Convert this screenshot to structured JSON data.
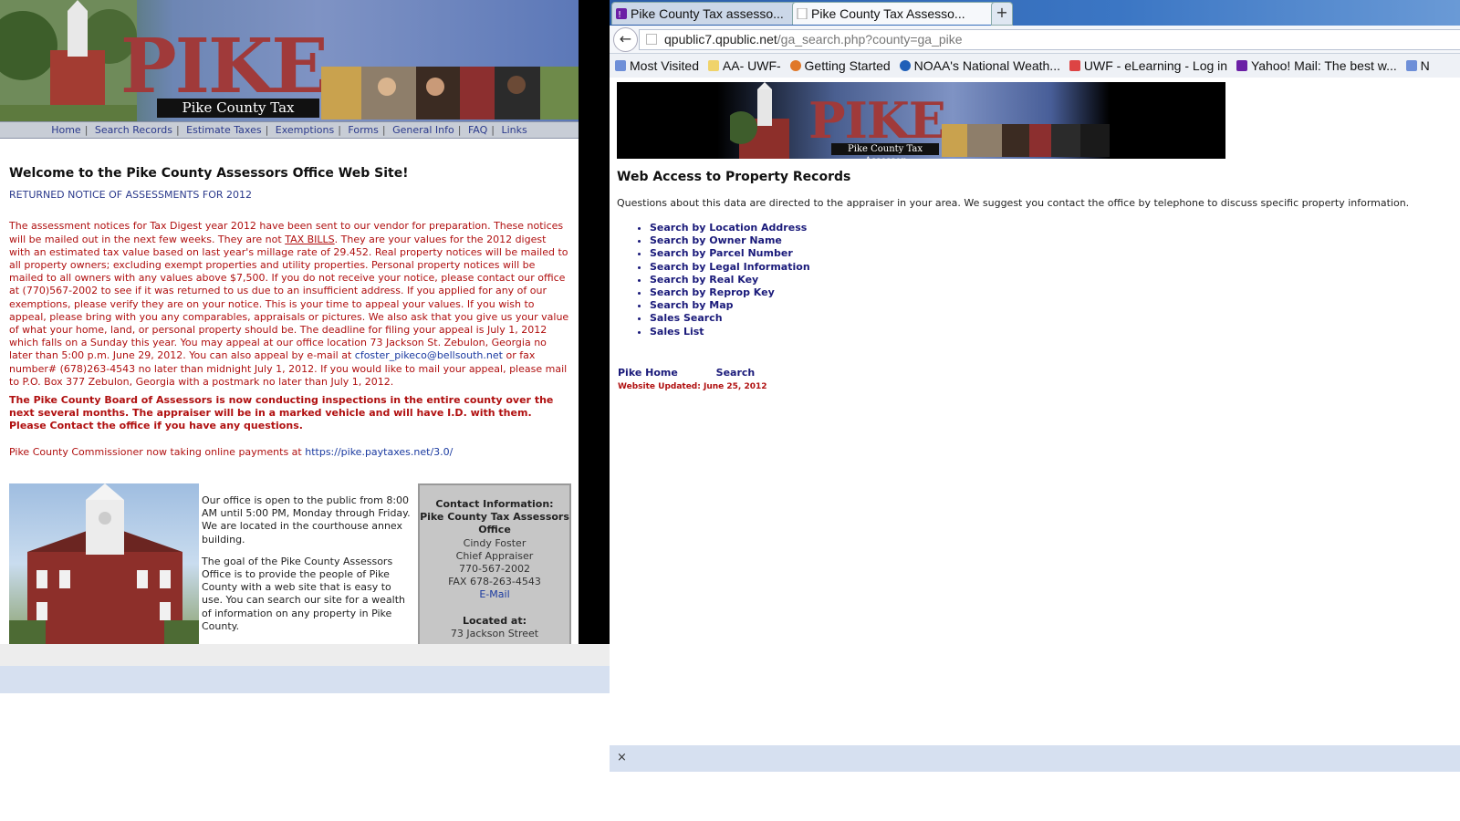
{
  "left": {
    "banner": {
      "logo_text": "PIKE",
      "tagline": "Pike County Tax Assessor"
    },
    "nav": [
      "Home",
      "Search Records",
      "Estimate Taxes",
      "Exemptions",
      "Forms",
      "General Info",
      "FAQ",
      "Links"
    ],
    "welcome_title": "Welcome to the Pike County Assessors Office Web Site!",
    "returned_notice": "RETURNED NOTICE OF ASSESSMENTS FOR 2012",
    "assessment_paragraph": {
      "before_link": "The assessment notices for Tax Digest year 2012 have been sent to our vendor for preparation. These notices will be mailed out in the next few weeks. They are not ",
      "tax_bills": "TAX BILLS",
      "middle": ". They are your values for the 2012 digest with an estimated tax value based on last year's millage rate of 29.452. Real property notices will be mailed to all property owners; excluding exempt properties and utility properties. Personal property notices will be mailed to all owners with any values above $7,500. If you do not receive your notice, please contact our office at (770)567-2002 to see if it was returned to us due to an insufficient address. If you applied for any of our exemptions, please verify they are on your notice. This is your time to appeal your values. If you wish to appeal, please bring with you any comparables, appraisals or pictures. We also ask that you give us your value of what your home, land, or personal property should be. The deadline for filing your appeal is July 1, 2012 which falls on a Sunday this year. You may appeal at our office location 73 Jackson St. Zebulon, Georgia no later than 5:00 p.m. June 29, 2012. You can also appeal by e-mail at ",
      "email": "cfoster_pikeco@bellsouth.net",
      "after_email": " or fax number# (678)263-4543 no later than midnight July 1, 2012. If you would like to mail your appeal, please mail to P.O. Box 377 Zebulon, Georgia with a postmark no later than July 1, 2012."
    },
    "inspection_notice": "The Pike County Board of Assessors is now conducting inspections in the entire county over the next several months. The appraiser will be in a marked vehicle and will have I.D. with them. Please Contact the office if you have any questions.",
    "commissioner_text": "Pike County Commissioner now taking online payments at ",
    "commissioner_link": "https://pike.paytaxes.net/3.0/",
    "office_hours": "Our office is open to the public from 8:00 AM until 5:00 PM, Monday through Friday. We are located in the courthouse annex building.",
    "office_goal": "The goal of the Pike County Assessors Office is to provide the people of Pike County with a web site that is easy to use. You can search our site for a wealth of information on any property in Pike County.",
    "contact": {
      "heading": "Contact Information:",
      "office": "Pike County Tax Assessors Office",
      "name": "Cindy Foster",
      "title": "Chief Appraiser",
      "phone": "770-567-2002",
      "fax": "FAX 678-263-4543",
      "email_label": "E-Mail",
      "located_heading": "Located at:",
      "street": "73 Jackson Street"
    }
  },
  "browser": {
    "tabs": [
      {
        "label": "Pike County Tax assesso..."
      },
      {
        "label": "Pike County Tax Assesso..."
      }
    ],
    "new_tab": "+",
    "url_host": "qpublic7.qpublic.net",
    "url_path": "/ga_search.php?county=ga_pike",
    "bookmarks": [
      "Most Visited",
      "AA- UWF-",
      "Getting Started",
      "NOAA's National Weath...",
      "UWF - eLearning - Log in",
      "Yahoo! Mail: The best w...",
      "N"
    ],
    "status_close": "×"
  },
  "right": {
    "banner": {
      "logo_text": "PIKE",
      "tagline": "Pike County Tax Assessor"
    },
    "title": "Web Access to Property Records",
    "description": "Questions about this data are directed to the appraiser in your area.  We suggest you contact the office by telephone to discuss specific property information.",
    "search_links": [
      "Search by Location Address",
      "Search by Owner Name",
      "Search by Parcel Number",
      "Search by Legal Information",
      "Search by Real Key",
      "Search by Reprop Key",
      "Search by Map",
      "Sales Search",
      "Sales List"
    ],
    "footer_links": [
      "Pike Home",
      "Search"
    ],
    "updated": "Website Updated: June 25, 2012"
  },
  "colors": {
    "accent_red": "#b01010",
    "link_blue": "#1a3aa0",
    "nav_blue": "#2b3a8c"
  }
}
